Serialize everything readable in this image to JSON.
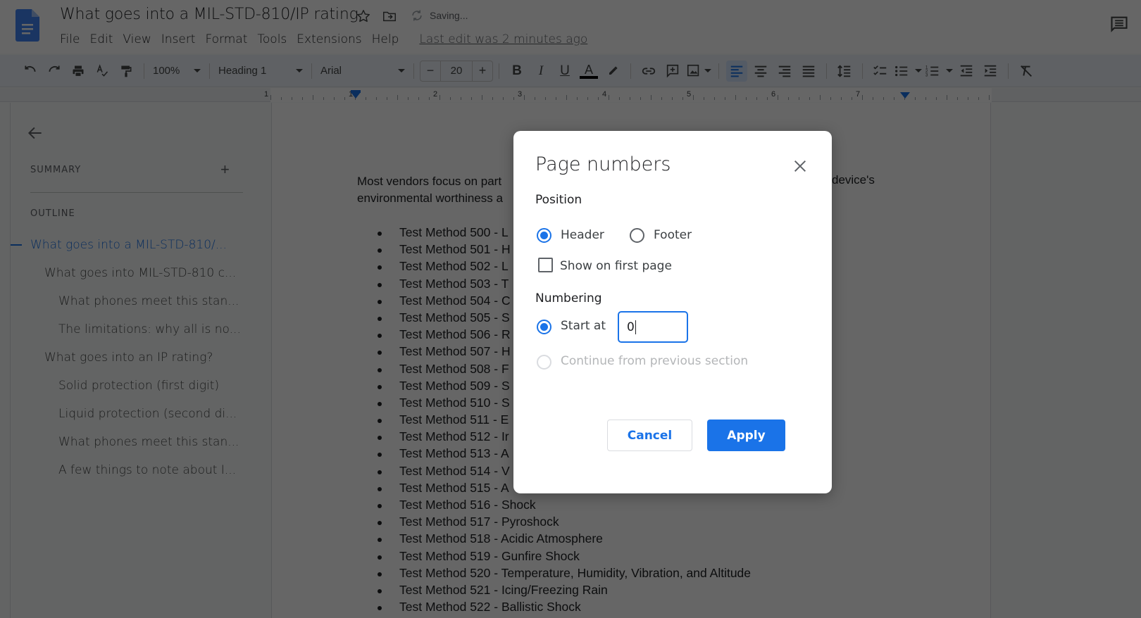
{
  "app": {
    "doc_title": "What goes into a MIL-STD-810/IP rating",
    "save_status": "Saving...",
    "menu": [
      "File",
      "Edit",
      "View",
      "Insert",
      "Format",
      "Tools",
      "Extensions",
      "Help"
    ],
    "last_edit": "Last edit was 2 minutes ago",
    "accent_color": "#1a73e8"
  },
  "toolbar": {
    "zoom": "100%",
    "style": "Heading 1",
    "font": "Arial",
    "font_size": "20",
    "minus": "−",
    "plus": "+",
    "bold": "B",
    "italic": "I",
    "underline": "U",
    "text_color": "A"
  },
  "ruler": {
    "labels": [
      "1",
      "1",
      "2",
      "3",
      "4",
      "5",
      "6",
      "7"
    ]
  },
  "sidebar": {
    "summary_label": "SUMMARY",
    "outline_label": "OUTLINE",
    "add_label": "+",
    "outline": [
      {
        "label": "What goes into a MIL-STD-810/...",
        "level": 1,
        "active": true
      },
      {
        "label": "What goes into MIL-STD-810 c...",
        "level": 2
      },
      {
        "label": "What phones meet this stan...",
        "level": 3
      },
      {
        "label": "The limitations: why all is no...",
        "level": 3
      },
      {
        "label": "What goes into an IP rating?",
        "level": 2
      },
      {
        "label": "Solid protection (first digit)",
        "level": 3
      },
      {
        "label": "Liquid protection (second di...",
        "level": 3
      },
      {
        "label": "What phones meet this stan...",
        "level": 3
      },
      {
        "label": "A few things to note about I...",
        "level": 3
      }
    ]
  },
  "document": {
    "para_line1": "Most vendors focus on part",
    "para_line2": "environmental worthiness a",
    "para_right": "device's",
    "list": [
      "Test Method 500 - L",
      "Test Method 501 - H",
      "Test Method 502 - L",
      "Test Method 503 - T",
      "Test Method 504 - C",
      "Test Method 505 - S",
      "Test Method 506 - R",
      "Test Method 507 - H",
      "Test Method 508 - F",
      "Test Method 509 - S",
      "Test Method 510 - S",
      "Test Method 511 - E",
      "Test Method 512 - Ir",
      "Test Method 513 - A",
      "Test Method 514 - V",
      "Test Method 515 - A",
      "Test Method 516 - Shock",
      "Test Method 517 - Pyroshock",
      "Test Method 518 - Acidic Atmosphere",
      "Test Method 519 - Gunfire Shock",
      "Test Method 520 - Temperature, Humidity, Vibration, and Altitude",
      "Test Method 521 - Icing/Freezing Rain",
      "Test Method 522 - Ballistic Shock"
    ]
  },
  "dialog": {
    "title": "Page numbers",
    "position_label": "Position",
    "header_label": "Header",
    "footer_label": "Footer",
    "position_selected": "Header",
    "show_first_page_label": "Show on first page",
    "show_first_page_checked": false,
    "numbering_label": "Numbering",
    "start_at_label": "Start at",
    "start_at_value": "0",
    "continue_label": "Continue from previous section",
    "numbering_selected": "Start at",
    "cancel_label": "Cancel",
    "apply_label": "Apply"
  }
}
